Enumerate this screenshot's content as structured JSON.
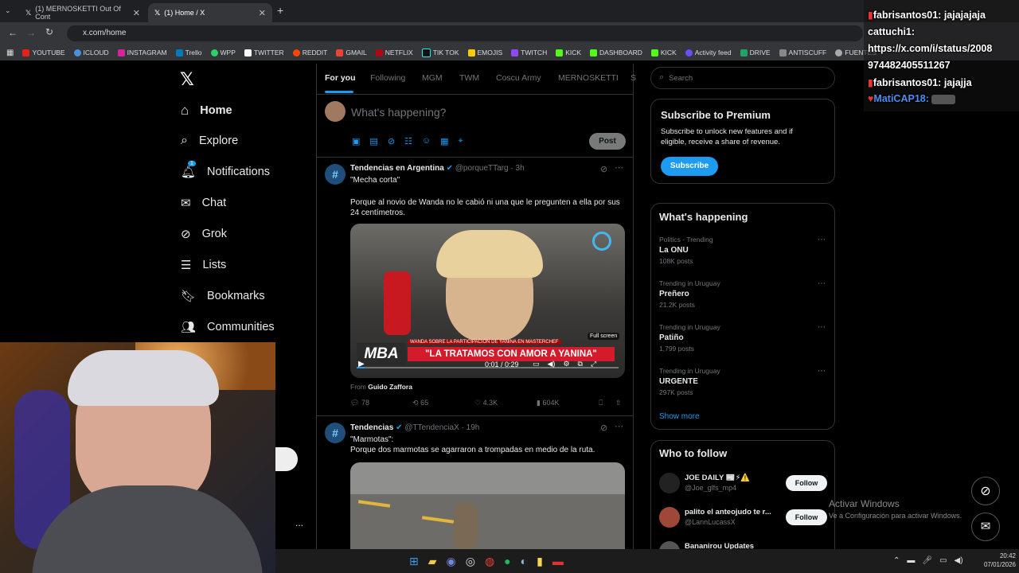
{
  "browser": {
    "tabs": [
      {
        "title": "(1) MERNOSKETTI Out Of Cont"
      },
      {
        "title": "(1) Home / X"
      }
    ],
    "url": "x.com/home",
    "bookmarks": [
      "YOUTUBE",
      "ICLOUD",
      "INSTAGRAM",
      "Trello",
      "WPP",
      "TWITTER",
      "REDDIT",
      "GMAIL",
      "NETFLIX",
      "TIK TOK",
      "EMOJIS",
      "TWITCH",
      "KICK",
      "DASHBOARD",
      "KICK",
      "Activity feed",
      "DRIVE",
      "ANTISCUFF",
      "FUENTES"
    ]
  },
  "nav": {
    "items": [
      "Home",
      "Explore",
      "Notifications",
      "Chat",
      "Grok",
      "Lists",
      "Bookmarks",
      "Communities"
    ],
    "notif_badge": "1",
    "more": "..."
  },
  "feed": {
    "tabs": [
      "For you",
      "Following",
      "MGM",
      "TWM",
      "Coscu Army",
      "MERNOSKETTI",
      "S"
    ],
    "compose_placeholder": "What's happening?",
    "post_button": "Post",
    "tweets": [
      {
        "author": "Tendencias en Argentina",
        "handle": "@porqueTTarg",
        "time": "· 3h",
        "line1": "\"Mecha corta\"",
        "line2": "Porque al novio de Wanda no le cabió ni una que le pregunten a ella por sus 24 centímetros.",
        "video": {
          "fullscreen": "Full screen",
          "subtitle": "WANDA SOBRE LA PARTICIPACIÓN DE YANINA EN MASTERCHEF",
          "headline": "\"LA TRATAMOS CON AMOR A YANINA\"",
          "brand": "MBA",
          "time": "0:01 / 0:29",
          "progress": 0.03
        },
        "from_label": "From",
        "from_name": "Guido Zaffora",
        "stats": {
          "replies": "78",
          "reposts": "65",
          "likes": "4.3K",
          "views": "604K"
        }
      },
      {
        "author": "Tendencias",
        "handle": "@TTendenciaX",
        "time": "· 19h",
        "line1": "\"Marmotas\":",
        "line2": "Porque dos marmotas se agarraron a trompadas en medio de la ruta."
      }
    ]
  },
  "sidebar": {
    "search_placeholder": "Search",
    "premium": {
      "title": "Subscribe to Premium",
      "text": "Subscribe to unlock new features and if eligible, receive a share of revenue.",
      "button": "Subscribe"
    },
    "whats_happening": {
      "title": "What's happening",
      "trends": [
        {
          "cat": "Politics · Trending",
          "name": "La ONU",
          "count": "108K posts"
        },
        {
          "cat": "Trending in Uruguay",
          "name": "Preñero",
          "count": "21.2K posts"
        },
        {
          "cat": "Trending in Uruguay",
          "name": "Patiño",
          "count": "1,799 posts"
        },
        {
          "cat": "Trending in Uruguay",
          "name": "URGENTE",
          "count": "297K posts"
        }
      ],
      "show_more": "Show more"
    },
    "who_to_follow": {
      "title": "Who to follow",
      "users": [
        {
          "name": "JOE DAILY 📰⚡⚠️",
          "handle": "@Joe_glfs_mp4",
          "button": "Follow"
        },
        {
          "name": "palito el anteojudo te r...",
          "handle": "@LannLucassX",
          "button": "Follow"
        },
        {
          "name": "Bananirou Updates",
          "handle": "",
          "button": ""
        }
      ]
    }
  },
  "chat_overlay": [
    {
      "user": "fabrisantos01:",
      "msg": "jajajajaja"
    },
    {
      "user": "cattuchi1:",
      "msg": ""
    },
    {
      "user": "",
      "msg": "https://x.com/i/status/2008"
    },
    {
      "user": "",
      "msg": "974482405511267"
    },
    {
      "user": "fabrisantos01:",
      "msg": "jajajja"
    },
    {
      "user": "MatiCAP18:",
      "msg": ""
    }
  ],
  "watermark": {
    "title": "Activar Windows",
    "sub": "Ve a Configuración para activar Windows."
  },
  "taskbar": {
    "time": "20:42",
    "date": "07/01/2026"
  },
  "colors": {
    "accent": "#1d9bf0",
    "background": "#000000",
    "border": "#2f3336",
    "muted": "#71767b"
  }
}
